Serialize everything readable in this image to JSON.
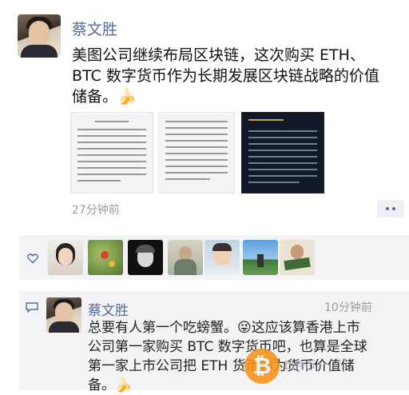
{
  "post": {
    "author": "蔡文胜",
    "text_line1": "美图公司继续布局区块链，这次购买 ETH、",
    "text_line2": "BTC 数字货币作为长期发展区块链战略的价值",
    "text_line3": "储备。🍌",
    "time": "27分钟前"
  },
  "comment": {
    "author": "蔡文胜",
    "time": "10分钟前",
    "line1": "总要有人第一个吃螃蟹。😜这应该算香港上市",
    "line2": "公司第一家购买 BTC 数字货币吧，也算是全球",
    "line3": "第一家上市公司把 ETH 货币作为货币价值储",
    "line4": "备。🍌"
  },
  "icons": {
    "more": "ellipsis-icon",
    "like": "heart-icon",
    "comment": "comment-bubble-icon",
    "watermark": "bitcoin-logo"
  },
  "watermark": {
    "glyph": "₿",
    "text": "比特币"
  },
  "colors": {
    "name_link": "#576b95",
    "section_bg": "#f3f3f5",
    "time_gray": "#9b9b9b",
    "bitcoin_orange": "#f7931a"
  }
}
